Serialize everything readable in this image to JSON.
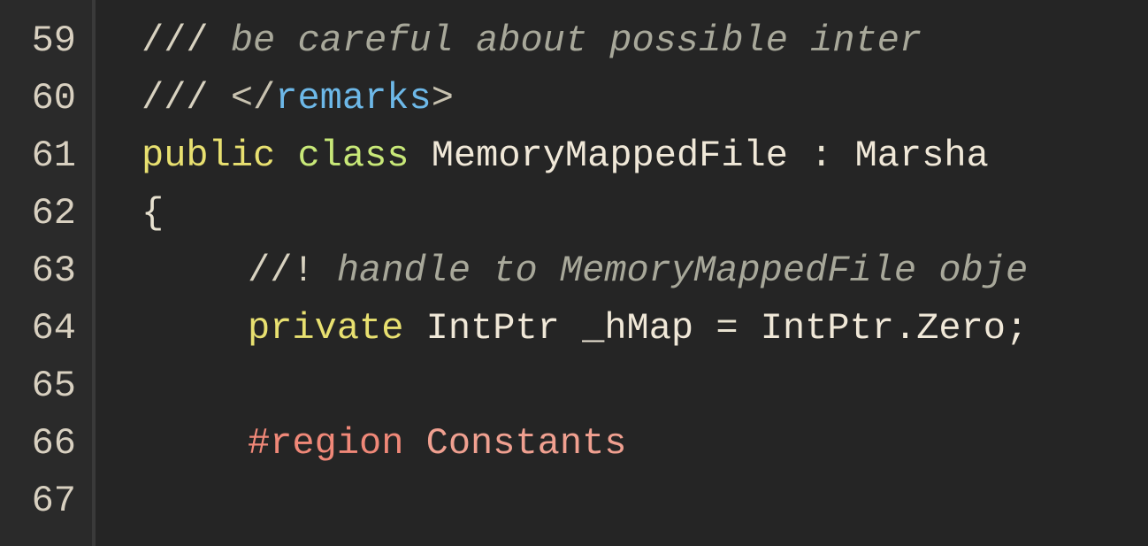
{
  "lines": {
    "59": {
      "num": "59",
      "slashes": "///",
      "comment": "    be careful about possible inter"
    },
    "60": {
      "num": "60",
      "slashes": "/// ",
      "open": "</",
      "tag": "remarks",
      "close": ">"
    },
    "61": {
      "num": "61",
      "kw1": "public",
      "kw2": "class",
      "name": "MemoryMappedFile",
      "colon": " : ",
      "base": "Marsha"
    },
    "62": {
      "num": "62",
      "brace": "{"
    },
    "63": {
      "num": "63",
      "slashes": "//!",
      "comment": " handle to MemoryMappedFile obje"
    },
    "64": {
      "num": "64",
      "kw": "private",
      "type": "IntPtr",
      "name": "_hMap",
      "eq": " = ",
      "val": "IntPtr.Zero;"
    },
    "65": {
      "num": "65"
    },
    "66": {
      "num": "66",
      "region": "#region",
      "rname": " Constants"
    },
    "67": {
      "num": "67"
    }
  }
}
